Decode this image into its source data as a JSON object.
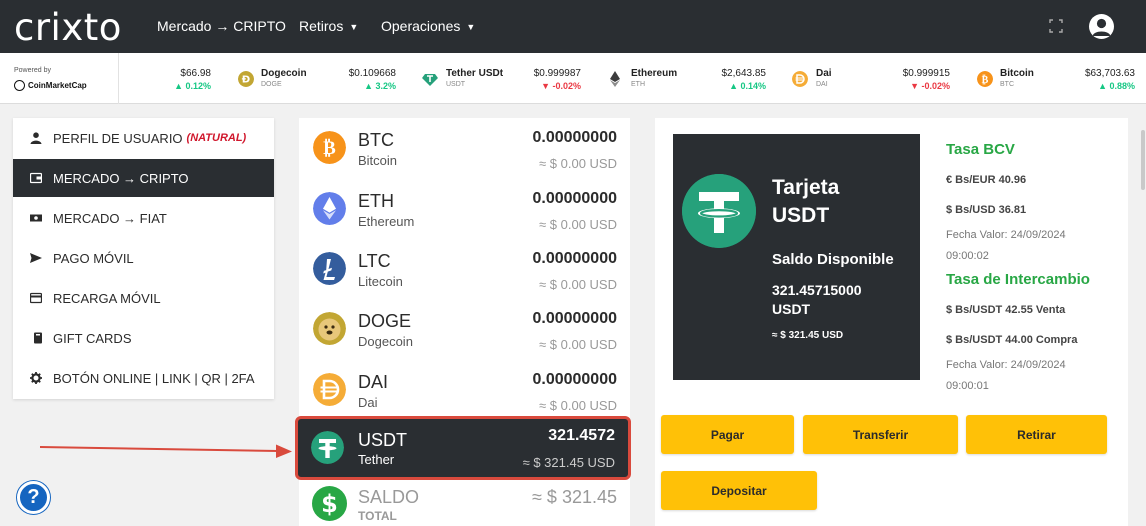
{
  "brand": {
    "logo": "crixto"
  },
  "nav": {
    "items": [
      {
        "label": "Mercado → CRIPTO",
        "dropdown": false
      },
      {
        "label": "Retiros",
        "dropdown": true
      },
      {
        "label": "Operaciones",
        "dropdown": true
      }
    ]
  },
  "ticker": {
    "powered_label": "Powered by",
    "provider": "CoinMarketCap",
    "items": [
      {
        "name": "",
        "symbol": "",
        "price": "$66.98",
        "change": "▲ 0.12%",
        "direction": "up"
      },
      {
        "name": "Dogecoin",
        "symbol": "DOGE",
        "price": "$0.109668",
        "change": "▲ 3.2%",
        "direction": "up",
        "icon": "doge-icon",
        "color": "#c2a633"
      },
      {
        "name": "Tether USDt",
        "symbol": "USDT",
        "price": "$0.999987",
        "change": "▼ -0.02%",
        "direction": "down",
        "icon": "tether-icon",
        "color": "#26a17b"
      },
      {
        "name": "Ethereum",
        "symbol": "ETH",
        "price": "$2,643.85",
        "change": "▲ 0.14%",
        "direction": "up",
        "icon": "ethereum-icon",
        "color": "#3c3c3d"
      },
      {
        "name": "Dai",
        "symbol": "DAI",
        "price": "$0.999915",
        "change": "▼ -0.02%",
        "direction": "down",
        "icon": "dai-icon",
        "color": "#f5ac37"
      },
      {
        "name": "Bitcoin",
        "symbol": "BTC",
        "price": "$63,703.63",
        "change": "▲ 0.88%",
        "direction": "up",
        "icon": "bitcoin-icon",
        "color": "#f7931a"
      }
    ]
  },
  "menu": {
    "items": [
      {
        "label": "PERFIL DE USUARIO",
        "badge": "(NATURAL)",
        "icon": "user-icon",
        "active": false
      },
      {
        "label": "MERCADO → CRIPTO",
        "icon": "wallet-icon",
        "active": true
      },
      {
        "label": "MERCADO → FIAT",
        "icon": "cash-icon",
        "active": false
      },
      {
        "label": "PAGO MÓVIL",
        "icon": "send-icon",
        "active": false
      },
      {
        "label": "RECARGA MÓVIL",
        "icon": "card-icon",
        "active": false
      },
      {
        "label": "GIFT CARDS",
        "icon": "gift-card-icon",
        "active": false
      },
      {
        "label": "BOTÓN ONLINE | LINK | QR | 2FA",
        "icon": "gear-icon",
        "active": false
      }
    ]
  },
  "assets": [
    {
      "symbol": "BTC",
      "name": "Bitcoin",
      "balance": "0.00000000",
      "usd": "≈ $ 0.00 USD",
      "color": "#f7931a"
    },
    {
      "symbol": "ETH",
      "name": "Ethereum",
      "balance": "0.00000000",
      "usd": "≈ $ 0.00 USD",
      "color": "#627eea"
    },
    {
      "symbol": "LTC",
      "name": "Litecoin",
      "balance": "0.00000000",
      "usd": "≈ $ 0.00 USD",
      "color": "#345d9d"
    },
    {
      "symbol": "DOGE",
      "name": "Dogecoin",
      "balance": "0.00000000",
      "usd": "≈ $ 0.00 USD",
      "color": "#c2a633"
    },
    {
      "symbol": "DAI",
      "name": "Dai",
      "balance": "0.00000000",
      "usd": "≈ $ 0.00 USD",
      "color": "#f5ac37"
    },
    {
      "symbol": "USDT",
      "name": "Tether",
      "balance": "321.4572",
      "usd": "≈ $ 321.45 USD",
      "color": "#26a17b",
      "selected": true
    }
  ],
  "saldo": {
    "label": "SALDO",
    "sub": "TOTAL",
    "amount": "≈ $ 321.45"
  },
  "card": {
    "title_line1": "Tarjeta",
    "title_line2": "USDT",
    "balance_label": "Saldo Disponible",
    "balance_amount": "321.45715000",
    "balance_unit": "USDT",
    "balance_usd": "≈ $ 321.45 USD"
  },
  "rates": {
    "bcv_title": "Tasa BCV",
    "bcv_eur": "€ Bs/EUR   40.96",
    "bcv_usd": "$ Bs/USD   36.81",
    "bcv_date_line1": "Fecha Valor: 24/09/2024",
    "bcv_date_line2": "09:00:02",
    "exchange_title": "Tasa de Intercambio",
    "sell": "$ Bs/USDT   42.55 Venta",
    "buy": "$ Bs/USDT   44.00 Compra",
    "ex_date_line1": "Fecha Valor: 24/09/2024",
    "ex_date_line2": "09:00:01"
  },
  "actions": {
    "pay": "Pagar",
    "transfer": "Transferir",
    "withdraw": "Retirar",
    "deposit": "Depositar"
  },
  "help": {
    "label": "?"
  },
  "colors": {
    "dark": "#2a2e32",
    "accent": "#ffc107",
    "green": "#28a745",
    "highlight": "#d94a3d"
  }
}
